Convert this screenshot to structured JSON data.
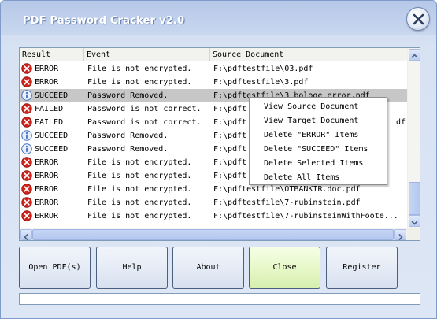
{
  "window": {
    "title": "PDF Password Cracker v2.0"
  },
  "list": {
    "headers": [
      "Result",
      "Event",
      "Source Document"
    ],
    "rows": [
      {
        "icon": "error-icon",
        "result": "ERROR",
        "event": "File is not encrypted.",
        "source": "F:\\pdftestfile\\03.pdf",
        "selected": false
      },
      {
        "icon": "error-icon",
        "result": "ERROR",
        "event": "File is not encrypted.",
        "source": "F:\\pdftestfile\\3.pdf",
        "selected": false
      },
      {
        "icon": "info-icon",
        "result": "SUCCEED",
        "event": "Password Removed.",
        "source": "F:\\pdftestfile\\3 bologe error.pdf",
        "selected": true
      },
      {
        "icon": "error-icon",
        "result": "FAILED",
        "event": "Password is not correct.",
        "source": "F:\\pdft",
        "selected": false
      },
      {
        "icon": "error-icon",
        "result": "FAILED",
        "event": "Password is not correct.",
        "source": "F:\\pdft",
        "tail": "df",
        "selected": false
      },
      {
        "icon": "info-icon",
        "result": "SUCCEED",
        "event": "Password Removed.",
        "source": "F:\\pdft",
        "selected": false
      },
      {
        "icon": "info-icon",
        "result": "SUCCEED",
        "event": "Password Removed.",
        "source": "F:\\pdft",
        "selected": false
      },
      {
        "icon": "error-icon",
        "result": "ERROR",
        "event": "File is not encrypted.",
        "source": "F:\\pdft",
        "selected": false
      },
      {
        "icon": "error-icon",
        "result": "ERROR",
        "event": "File is not encrypted.",
        "source": "F:\\pdft",
        "selected": false
      },
      {
        "icon": "error-icon",
        "result": "ERROR",
        "event": "File is not encrypted.",
        "source": "F:\\pdftestfile\\OTBANKIR.doc.pdf",
        "selected": false
      },
      {
        "icon": "error-icon",
        "result": "ERROR",
        "event": "File is not encrypted.",
        "source": "F:\\pdftestfile\\7-rubinstein.pdf",
        "selected": false
      },
      {
        "icon": "error-icon",
        "result": "ERROR",
        "event": "File is not encrypted.",
        "source": "F:\\pdftestfile\\7-rubinsteinWithFoote...",
        "selected": false
      }
    ]
  },
  "context_menu": {
    "items": [
      "View Source Document",
      "View Target Document",
      "Delete \"ERROR\" Items",
      "Delete \"SUCCEED\" Items",
      "Delete Selected Items",
      "Delete All Items"
    ]
  },
  "buttons": {
    "open": "Open PDF(s)",
    "help": "Help",
    "about": "About",
    "close": "Close",
    "register": "Register"
  },
  "colors": {
    "error": "#d2231c",
    "info": "#3f6fc2",
    "selected_row": "#c7c7c7",
    "close_button": "#e7f8c9"
  }
}
